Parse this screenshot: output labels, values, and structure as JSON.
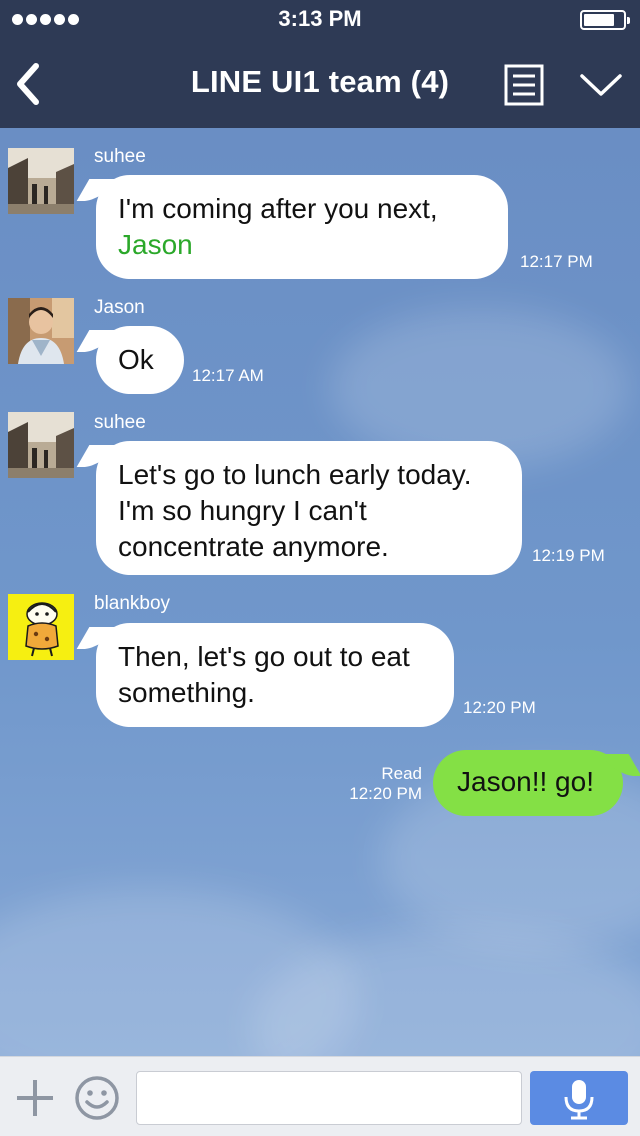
{
  "status_bar": {
    "time": "3:13 PM",
    "battery_level": 0.78
  },
  "header": {
    "title": "LINE UI1 team (4)",
    "icons": [
      "back-chevron-icon",
      "notes-icon",
      "chevron-down-icon"
    ]
  },
  "messages": [
    {
      "sender": "suhee",
      "text_lines": [
        "I'm coming after you next,"
      ],
      "mention": "Jason",
      "time": "12:17 PM",
      "avatar": "street-photo-avatar"
    },
    {
      "sender": "Jason",
      "text_lines": [
        "Ok"
      ],
      "time": "12:17 AM",
      "avatar": "man-portrait-avatar"
    },
    {
      "sender": "suhee",
      "text_lines": [
        "Let's go to lunch early today.",
        "I'm so hungry I can't",
        "concentrate anymore."
      ],
      "time": "12:19 PM",
      "avatar": "street-photo-avatar"
    },
    {
      "sender": "blankboy",
      "text_lines": [
        "Then, let's go out to eat",
        "something."
      ],
      "time": "12:20 PM",
      "avatar": "cartoon-character-avatar"
    }
  ],
  "outgoing": {
    "text": "Jason!! go!",
    "read_label": "Read",
    "time": "12:20 PM"
  },
  "input_bar": {
    "placeholder": "",
    "icons": [
      "plus-icon",
      "emoji-icon",
      "microphone-icon"
    ]
  },
  "colors": {
    "header_bg": "#2e3a55",
    "chat_bg": "#6f93c6",
    "outgoing_bubble": "#84e045",
    "mention": "#2ba82a",
    "mic_button": "#5b8be3"
  }
}
